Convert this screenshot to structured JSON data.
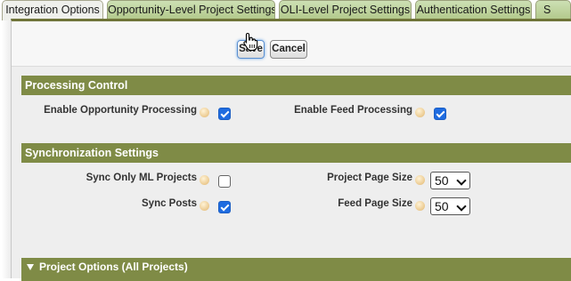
{
  "tabs": [
    {
      "label": "Integration Options",
      "active": true
    },
    {
      "label": "Opportunity-Level Project Settings"
    },
    {
      "label": "OLI-Level Project Settings"
    },
    {
      "label": "Authentication Settings"
    },
    {
      "label": "S"
    }
  ],
  "toolbar": {
    "save_label": "Save",
    "cancel_label": "Cancel"
  },
  "processing": {
    "title": "Processing Control",
    "enable_opportunity": {
      "label": "Enable Opportunity Processing",
      "checked": true
    },
    "enable_feed": {
      "label": "Enable Feed Processing",
      "checked": true
    }
  },
  "sync": {
    "title": "Synchronization Settings",
    "sync_only_ml": {
      "label": "Sync Only ML Projects",
      "checked": false
    },
    "sync_posts": {
      "label": "Sync Posts",
      "checked": true
    },
    "project_page_size": {
      "label": "Project Page Size",
      "value": "50"
    },
    "feed_page_size": {
      "label": "Feed Page Size",
      "value": "50"
    }
  },
  "project_options": {
    "title": "Project Options (All Projects)"
  },
  "colors": {
    "section_bar": "#7f8b46",
    "tab_green": "#b3c98c",
    "checkbox_blue": "#1f6ce0"
  }
}
